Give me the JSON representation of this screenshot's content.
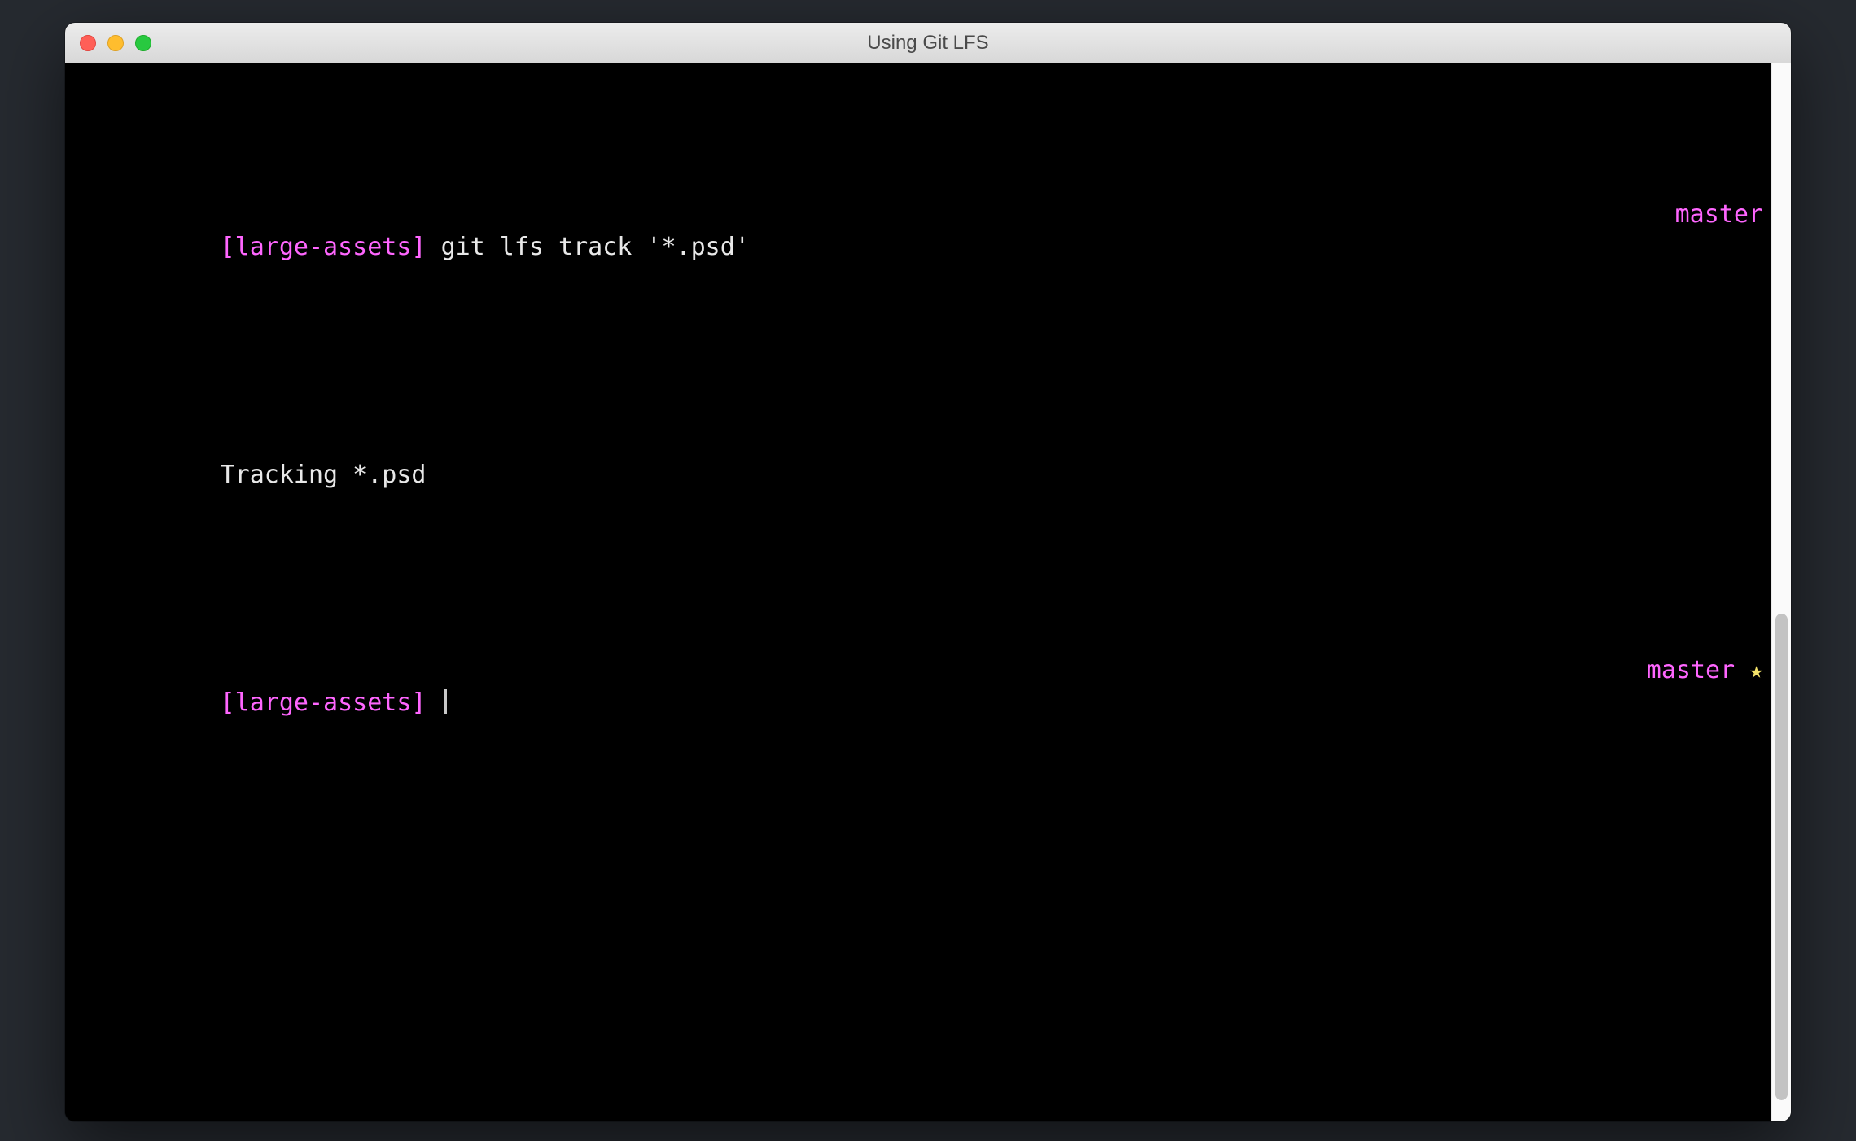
{
  "window": {
    "title": "Using Git LFS"
  },
  "terminal": {
    "lines": [
      {
        "prompt": "[large-assets]",
        "command": "git lfs track '*.psd'",
        "branch": "master",
        "star": false
      },
      {
        "output": "Tracking *.psd"
      },
      {
        "prompt": "[large-assets]",
        "command": "",
        "cursor": true,
        "branch": "master",
        "star": true
      }
    ],
    "star_glyph": "★"
  }
}
